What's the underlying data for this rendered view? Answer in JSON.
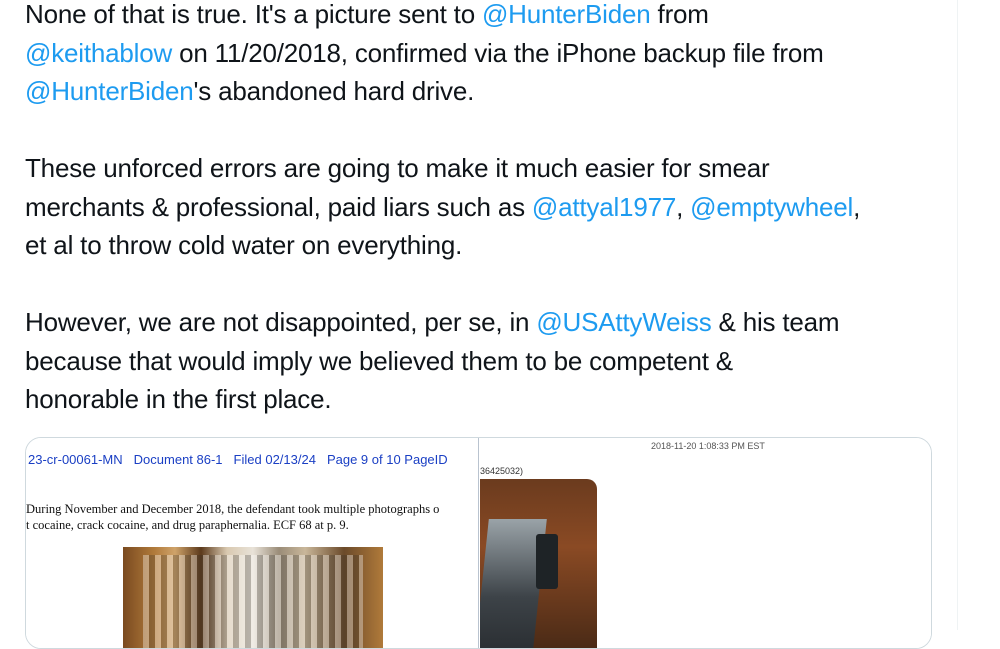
{
  "tweet": {
    "p1": {
      "l1_a": "None of that is true. It's a picture sent to ",
      "l1_m1": "@HunterBiden",
      "l1_b": " from",
      "l2_m1": "@keithablow",
      "l2_a": " on 11/20/2018, confirmed via the iPhone backup file from",
      "l3_m1": "@HunterBiden",
      "l3_a": "'s abandoned hard drive."
    },
    "p2": {
      "l1_a": "These unforced errors are going to make it much easier for smear",
      "l2_a": "merchants & professional, paid liars such as ",
      "l2_m1": "@attyal1977",
      "l2_b": ", ",
      "l2_m2": "@emptywheel",
      "l2_c": ",",
      "l3_a": "et al to throw cold water on everything."
    },
    "p3": {
      "l1_a": "However, we are not disappointed, per se, in ",
      "l1_m1": "@USAttyWeiss",
      "l1_b": " & his team",
      "l2_a": "because that would imply we believed them to be competent &",
      "l3_a": "honorable in the first place."
    }
  },
  "media": {
    "doc_header": {
      "case": "23-cr-00061-MN",
      "document": "Document 86-1",
      "filed": "Filed 02/13/24",
      "page": "Page 9 of 10 PageID"
    },
    "doc_body_line1": "During November and December 2018, the defendant took multiple photographs o",
    "doc_body_line2": "t cocaine, crack cocaine, and drug paraphernalia.  ECF 68 at p. 9.",
    "timestamp": "2018-11-20 1:08:33 PM EST",
    "partial_id": "36425032)"
  },
  "colors": {
    "mention": "#1d9bf0",
    "text": "#0f1419",
    "doc_header": "#1a3fc4"
  }
}
